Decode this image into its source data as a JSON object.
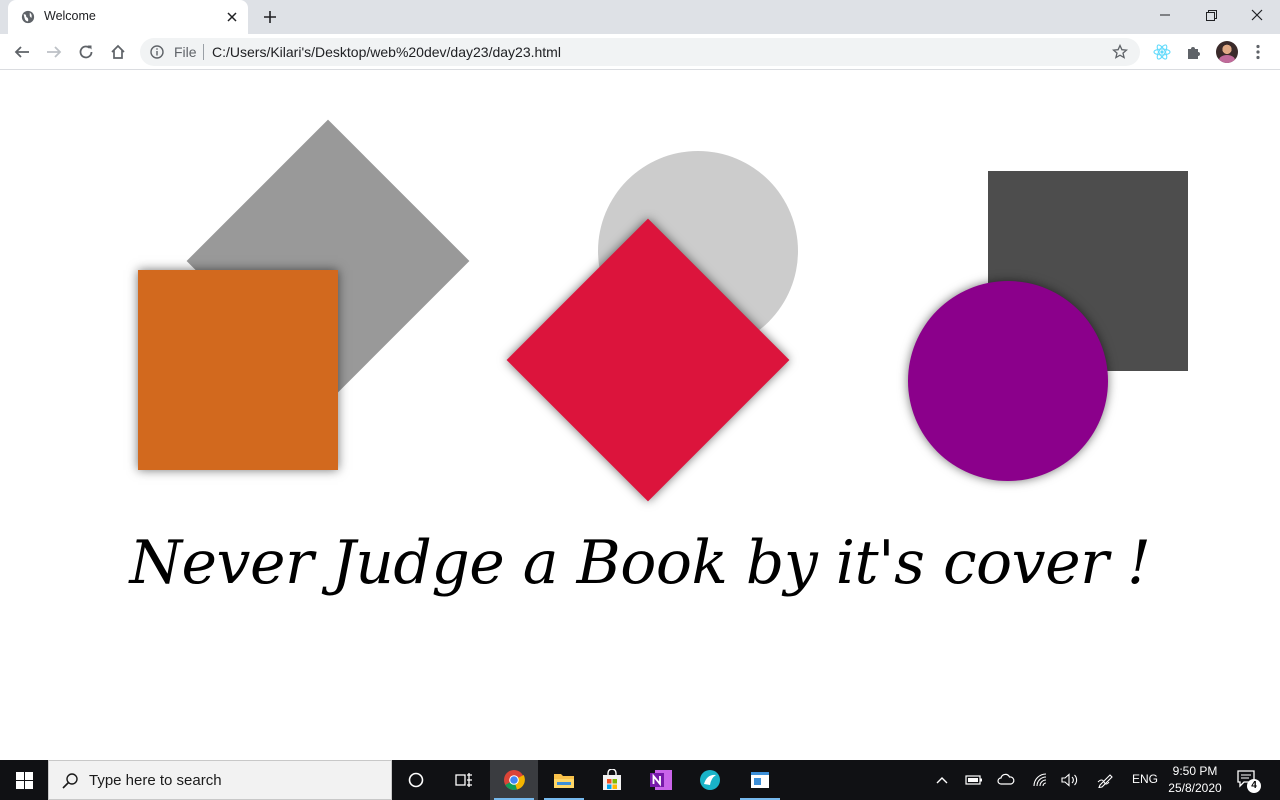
{
  "browser": {
    "tab": {
      "title": "Welcome"
    },
    "omnibox": {
      "scheme_label": "File",
      "url": "C:/Users/Kilari's/Desktop/web%20dev/day23/day23.html"
    }
  },
  "page": {
    "tagline": "Never Judge a Book by it's cover !",
    "colors": {
      "gray_diamond": "#999999",
      "orange_square": "#d2691e",
      "light_circle": "#cccccc",
      "red_diamond": "#dc143c",
      "dark_square": "#4d4d4d",
      "purple_circle": "#8b008b"
    }
  },
  "taskbar": {
    "search_placeholder": "Type here to search",
    "language": "ENG",
    "time": "9:50 PM",
    "date": "25/8/2020",
    "notification_count": "4",
    "apps": [
      "cortana-icon",
      "task-view-icon",
      "chrome-icon",
      "file-explorer-icon",
      "store-icon",
      "onenote-icon",
      "app-icon",
      "notepad-icon"
    ]
  }
}
